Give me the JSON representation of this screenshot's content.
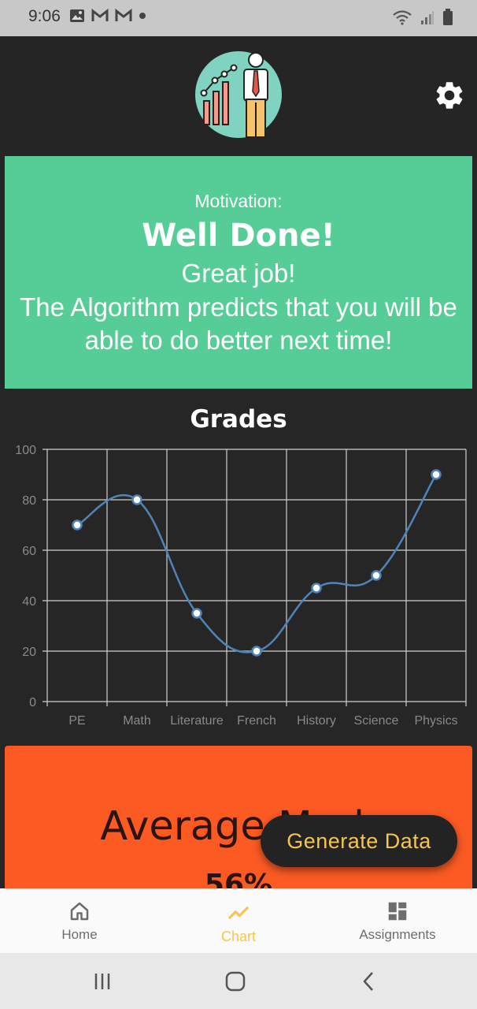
{
  "status_bar": {
    "time": "9:06",
    "icons_left": [
      "image-icon",
      "gmail-icon",
      "gmail-icon",
      "dot-icon"
    ],
    "icons_right": [
      "wifi-icon",
      "signal-icon",
      "battery-icon"
    ]
  },
  "header": {
    "logo_icon": "business-chart-logo-icon",
    "settings_icon": "gear-icon"
  },
  "motivation": {
    "label": "Motivation:",
    "headline": "Well Done!",
    "sub": "Great job!",
    "message": "The Algorithm predicts that you will be able to do better next time!",
    "color": "#56cd96"
  },
  "chart_data": {
    "type": "line",
    "title": "Grades",
    "categories": [
      "PE",
      "Math",
      "Literature",
      "French",
      "History",
      "Science",
      "Physics"
    ],
    "series": [
      {
        "values": [
          70,
          80,
          35,
          20,
          45,
          50,
          90
        ],
        "color": "#4f84b8"
      }
    ],
    "ylim": [
      0,
      100
    ],
    "yticks": [
      0,
      20,
      40,
      60,
      80,
      100
    ],
    "grid": true,
    "smooth": true
  },
  "average": {
    "title": "Average Mark",
    "value": "56%",
    "color": "#fb5a22"
  },
  "fab": {
    "label": "Generate Data"
  },
  "bottom_nav": {
    "items": [
      {
        "label": "Home",
        "icon": "home-icon",
        "active": false
      },
      {
        "label": "Chart",
        "icon": "chart-line-icon",
        "active": true
      },
      {
        "label": "Assignments",
        "icon": "dashboard-icon",
        "active": false
      }
    ],
    "active_color": "#f4c64f"
  },
  "system_nav": {
    "icons": [
      "recent-apps-icon",
      "home-circle-icon",
      "back-icon"
    ]
  }
}
